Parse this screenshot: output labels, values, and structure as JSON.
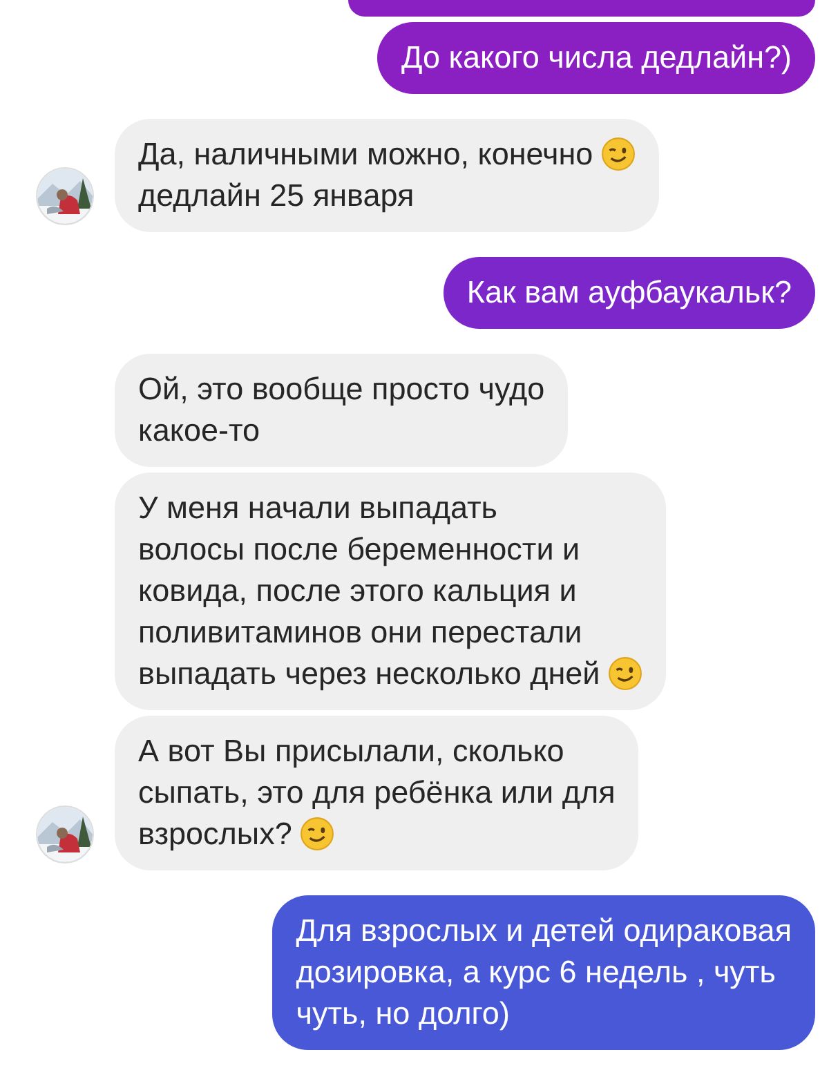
{
  "messages": [
    {
      "kind": "clipped",
      "color": "#8a1fc2"
    },
    {
      "kind": "outgoing",
      "color": "#8a1fc2",
      "lines": [
        {
          "text": "До какого числа дедлайн?)",
          "wink": false
        }
      ]
    },
    {
      "kind": "incoming",
      "avatar": true,
      "lines": [
        {
          "text": "Да, наличными можно, конечно",
          "wink": true
        },
        {
          "text": "дедлайн 25 января",
          "wink": false
        }
      ]
    },
    {
      "kind": "outgoing",
      "color": "#7c27c9",
      "lines": [
        {
          "text": "Как вам ауфбаукальк?",
          "wink": false
        }
      ]
    },
    {
      "kind": "incoming",
      "avatar": false,
      "lines": [
        {
          "text": "Ой, это вообще просто чудо",
          "wink": false
        },
        {
          "text": "какое-то",
          "wink": false
        }
      ]
    },
    {
      "kind": "incoming",
      "avatar": false,
      "lines": [
        {
          "text": "У меня начали выпадать",
          "wink": false
        },
        {
          "text": "волосы после беременности и",
          "wink": false
        },
        {
          "text": "ковида, после этого кальция и",
          "wink": false
        },
        {
          "text": "поливитаминов они перестали",
          "wink": false
        },
        {
          "text": "выпадать через несколько дней",
          "wink": true
        }
      ]
    },
    {
      "kind": "incoming",
      "avatar": true,
      "lines": [
        {
          "text": "А вот Вы присылали, сколько",
          "wink": false
        },
        {
          "text": "сыпать, это для ребёнка или для",
          "wink": false
        },
        {
          "text": "взрослых?",
          "wink": true
        }
      ]
    },
    {
      "kind": "outgoing",
      "color": "#4858d6",
      "lines": [
        {
          "text": "Для взрослых и детей одираковая",
          "wink": false
        },
        {
          "text": "дозировка, а курс 6 недель , чуть",
          "wink": false
        },
        {
          "text": "чуть, но долго)",
          "wink": false
        }
      ]
    }
  ]
}
